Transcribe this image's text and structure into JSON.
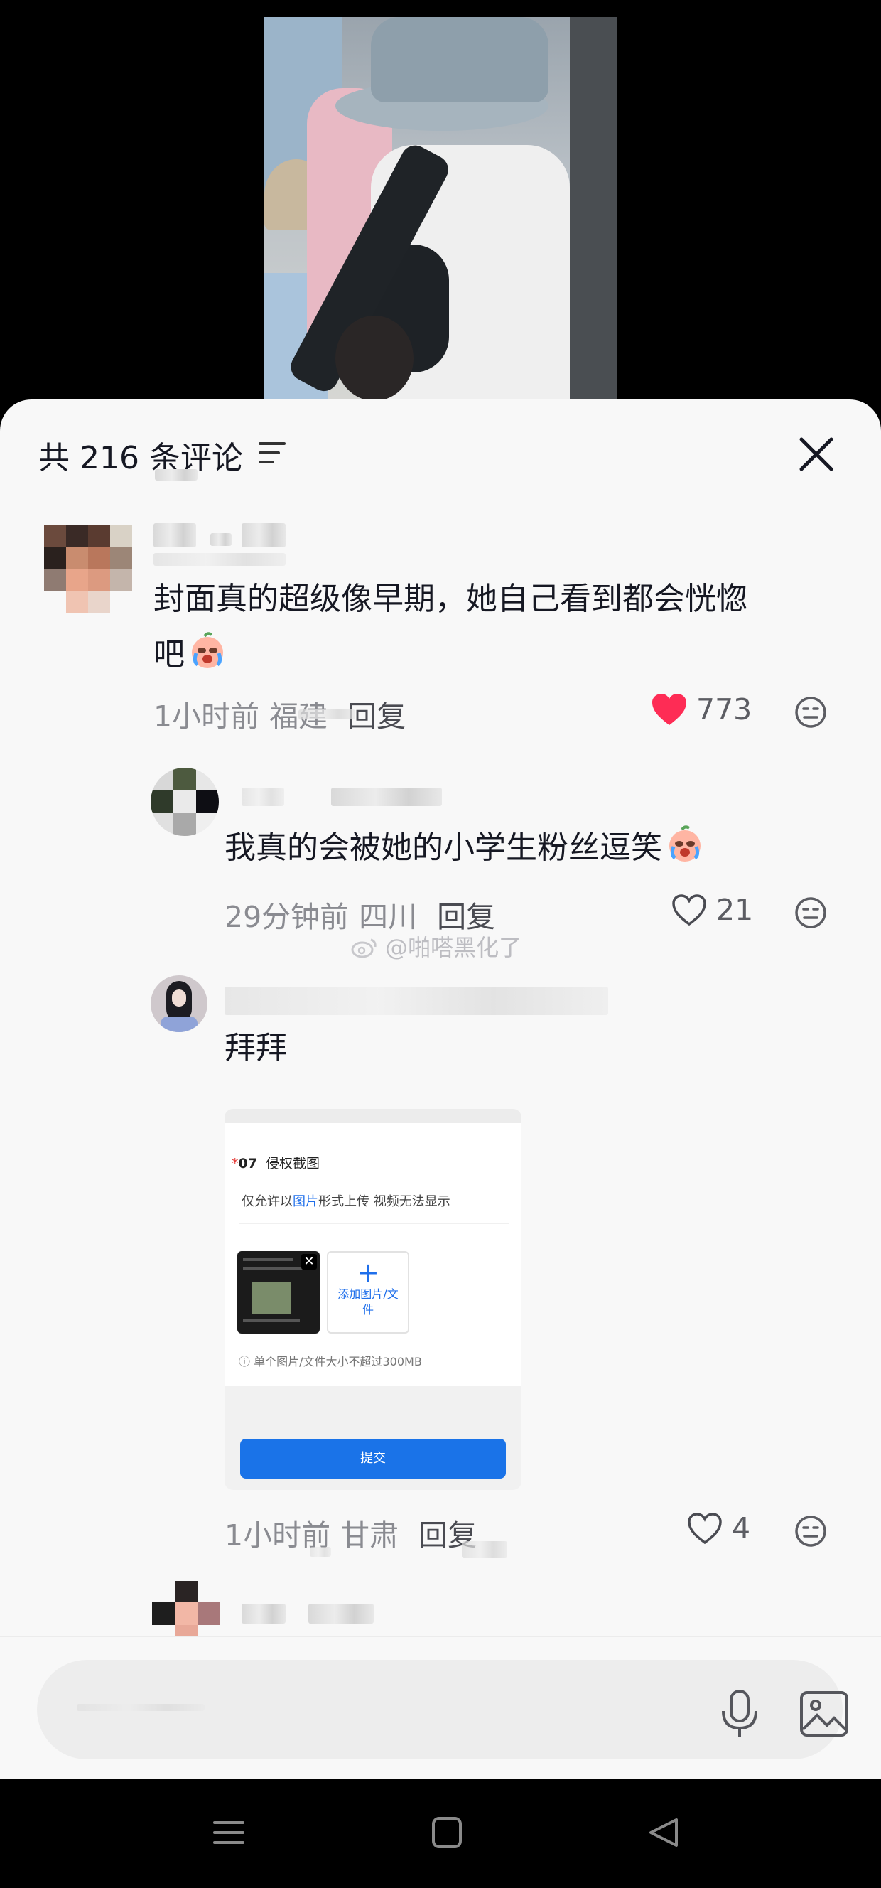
{
  "sheet": {
    "comment_count_label": "共 216 条评论",
    "close_icon": "close-icon",
    "filter_icon": "sort-icon"
  },
  "comments": [
    {
      "text_line1": "封面真的超级像早期，她自己看到都会恍惚",
      "text_line2": "吧",
      "emoji": "crying-face",
      "time": "1小时前",
      "location": "福建",
      "reply_label": "回复",
      "like_count": "773",
      "liked": true
    },
    {
      "text": "我真的会被她的小学生粉丝逗笑",
      "emoji": "crying-face",
      "time": "29分钟前",
      "location": "四川",
      "reply_label": "回复",
      "like_count": "21",
      "liked": false
    },
    {
      "text": "拜拜",
      "time": "1小时前",
      "location": "甘肃",
      "reply_label": "回复",
      "like_count": "4",
      "liked": false,
      "attachment": {
        "heading_num": "07",
        "heading_text": "侵权截图",
        "sub_prefix": "仅允许以",
        "sub_highlight": "图片",
        "sub_suffix": "形式上传 视频无法显示",
        "add_label": "添加图片/文件",
        "note": "ⓘ 单个图片/文件大小不超过300MB",
        "submit_label": "提交",
        "remove_icon": "close-icon"
      }
    }
  ],
  "watermark": "@啪嗒黑化了",
  "input": {
    "placeholder": "",
    "mic_icon": "microphone-icon",
    "image_icon": "image-icon"
  },
  "nav": {
    "menu_icon": "menu-icon",
    "home_icon": "home-square-icon",
    "back_icon": "back-triangle-icon"
  }
}
